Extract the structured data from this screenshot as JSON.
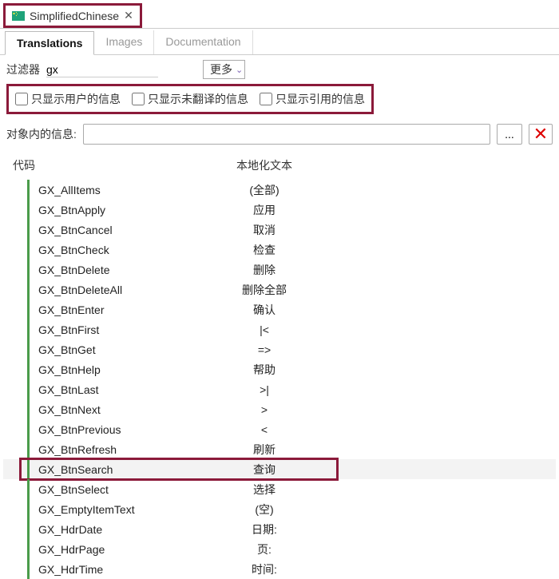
{
  "window_tab": {
    "title": "SimplifiedChinese"
  },
  "sub_tabs": {
    "translations": "Translations",
    "images": "Images",
    "documentation": "Documentation"
  },
  "filter": {
    "label": "过滤器",
    "value": "gx",
    "more_label": "更多"
  },
  "checkboxes": {
    "user_msgs": "只显示用户的信息",
    "untranslated": "只显示未翻译的信息",
    "referenced": "只显示引用的信息"
  },
  "object_info": {
    "label": "对象内的信息:",
    "value": "",
    "ellipsis": "..."
  },
  "table": {
    "headers": {
      "code": "代码",
      "localized": "本地化文本"
    },
    "rows": [
      {
        "code": "GX_AllItems",
        "local": "(全部)"
      },
      {
        "code": "GX_BtnApply",
        "local": "应用"
      },
      {
        "code": "GX_BtnCancel",
        "local": "取消"
      },
      {
        "code": "GX_BtnCheck",
        "local": "检查"
      },
      {
        "code": "GX_BtnDelete",
        "local": "删除"
      },
      {
        "code": "GX_BtnDeleteAll",
        "local": "删除全部"
      },
      {
        "code": "GX_BtnEnter",
        "local": "确认"
      },
      {
        "code": "GX_BtnFirst",
        "local": "|<"
      },
      {
        "code": "GX_BtnGet",
        "local": "=>"
      },
      {
        "code": "GX_BtnHelp",
        "local": "帮助"
      },
      {
        "code": "GX_BtnLast",
        "local": ">|"
      },
      {
        "code": "GX_BtnNext",
        "local": ">"
      },
      {
        "code": "GX_BtnPrevious",
        "local": "<"
      },
      {
        "code": "GX_BtnRefresh",
        "local": "刷新"
      },
      {
        "code": "GX_BtnSearch",
        "local": "查询",
        "highlighted": true
      },
      {
        "code": "GX_BtnSelect",
        "local": "选择"
      },
      {
        "code": "GX_EmptyItemText",
        "local": "(空)"
      },
      {
        "code": "GX_HdrDate",
        "local": "日期:"
      },
      {
        "code": "GX_HdrPage",
        "local": "页:"
      },
      {
        "code": "GX_HdrTime",
        "local": "时间:"
      }
    ]
  }
}
